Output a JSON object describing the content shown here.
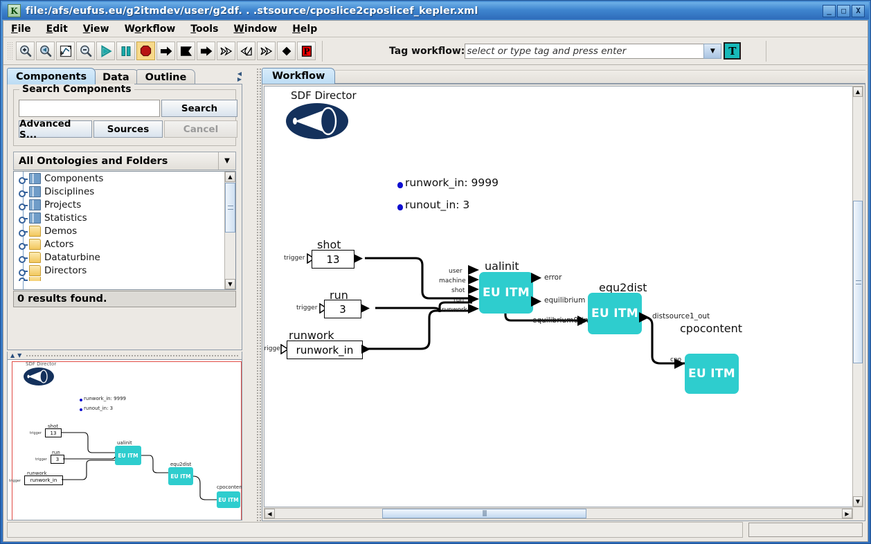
{
  "window": {
    "title": "file:/afs/eufus.eu/g2itmdev/user/g2df. . .stsource/cposlice2cposlicef_kepler.xml",
    "app_icon_letter": "K",
    "minimize_label": "_",
    "maximize_label": "□",
    "close_label": "X"
  },
  "menubar": {
    "items": [
      {
        "label": "File",
        "mnemonic": "F"
      },
      {
        "label": "Edit",
        "mnemonic": "E"
      },
      {
        "label": "View",
        "mnemonic": "V"
      },
      {
        "label": "Workflow",
        "mnemonic": "o"
      },
      {
        "label": "Tools",
        "mnemonic": "T"
      },
      {
        "label": "Window",
        "mnemonic": "W"
      },
      {
        "label": "Help",
        "mnemonic": "H"
      }
    ]
  },
  "toolbar": {
    "buttons": [
      {
        "name": "zoom-in-icon",
        "glyph": "zoom-in"
      },
      {
        "name": "zoom-reset-icon",
        "glyph": "zoom-back"
      },
      {
        "name": "zoom-fit-icon",
        "glyph": "zoom-fit"
      },
      {
        "name": "zoom-out-icon",
        "glyph": "zoom-out"
      },
      {
        "name": "run-icon",
        "glyph": "play"
      },
      {
        "name": "pause-icon",
        "glyph": "pause"
      },
      {
        "name": "stop-icon",
        "glyph": "stop"
      },
      {
        "name": "step-icon",
        "glyph": "arrow-right"
      },
      {
        "name": "flag-icon",
        "glyph": "flag"
      },
      {
        "name": "arrow-solid-icon",
        "glyph": "arrow-solid"
      },
      {
        "name": "double-arrow-icon",
        "glyph": "dbl-arrow"
      },
      {
        "name": "arrow-back-icon",
        "glyph": "dbl-arrow-back"
      },
      {
        "name": "double-arrow2-icon",
        "glyph": "dbl-arrow2"
      },
      {
        "name": "diamond-icon",
        "glyph": "diamond"
      },
      {
        "name": "pause-run-icon",
        "glyph": "P"
      }
    ],
    "tag_label": "Tag workflow:",
    "tag_placeholder": "select or type tag and press enter",
    "tag_value": "",
    "tag_dropdown_glyph": "▼",
    "tag_button_letter": "T"
  },
  "left_panel": {
    "tabs": [
      {
        "label": "Components",
        "active": true
      },
      {
        "label": "Data",
        "active": false
      },
      {
        "label": "Outline",
        "active": false
      }
    ],
    "search_group_title": "Search Components",
    "search_value": "",
    "search_button": "Search",
    "advanced_button": "Advanced S...",
    "sources_button": "Sources",
    "cancel_button": "Cancel",
    "ontology_selector": "All Ontologies and Folders",
    "ontology_arrow": "▼",
    "tree_items": [
      {
        "label": "Components",
        "icon": "book-icon"
      },
      {
        "label": "Disciplines",
        "icon": "book-icon"
      },
      {
        "label": "Projects",
        "icon": "book-icon"
      },
      {
        "label": "Statistics",
        "icon": "book-icon"
      },
      {
        "label": "Demos",
        "icon": "folder-icon"
      },
      {
        "label": "Actors",
        "icon": "folder-icon"
      },
      {
        "label": "Dataturbine",
        "icon": "folder-icon"
      },
      {
        "label": "Directors",
        "icon": "folder-icon"
      }
    ],
    "results_text": "0 results found."
  },
  "right_panel": {
    "tab_label": "Workflow"
  },
  "workflow": {
    "director": {
      "label": "SDF Director"
    },
    "parameters": [
      {
        "label": "runwork_in: 9999"
      },
      {
        "label": "runout_in: 3"
      }
    ],
    "param_boxes": [
      {
        "title": "shot",
        "value": "13",
        "trigger": "trigger"
      },
      {
        "title": "run",
        "value": "3",
        "trigger": "trigger"
      },
      {
        "title": "runwork",
        "value": "runwork_in",
        "trigger": "trigger"
      }
    ],
    "actors": [
      {
        "name": "ualinit",
        "body": "EU ITM"
      },
      {
        "name": "equ2dist",
        "body": "EU ITM"
      },
      {
        "name": "cpocontent",
        "body": "EU ITM"
      }
    ],
    "ports": {
      "ualinit_in": [
        "user",
        "machine",
        "shot",
        "run",
        "runwork"
      ],
      "ualinit_out": [
        "error",
        "equilibrium"
      ],
      "equ2dist_in": [
        "equilibrium0_in"
      ],
      "equ2dist_out": [
        "distsource1_out"
      ],
      "cpocontent_in": [
        "cpo"
      ]
    }
  },
  "statusbar": {
    "message": "",
    "progress_text": ""
  },
  "colors": {
    "actor_teal": "#2ecdce",
    "director_navy": "#14315c",
    "title_blue": "#2f6fbe",
    "bullet_blue": "#0f0fd0",
    "panel_gray": "#ece9e4"
  }
}
